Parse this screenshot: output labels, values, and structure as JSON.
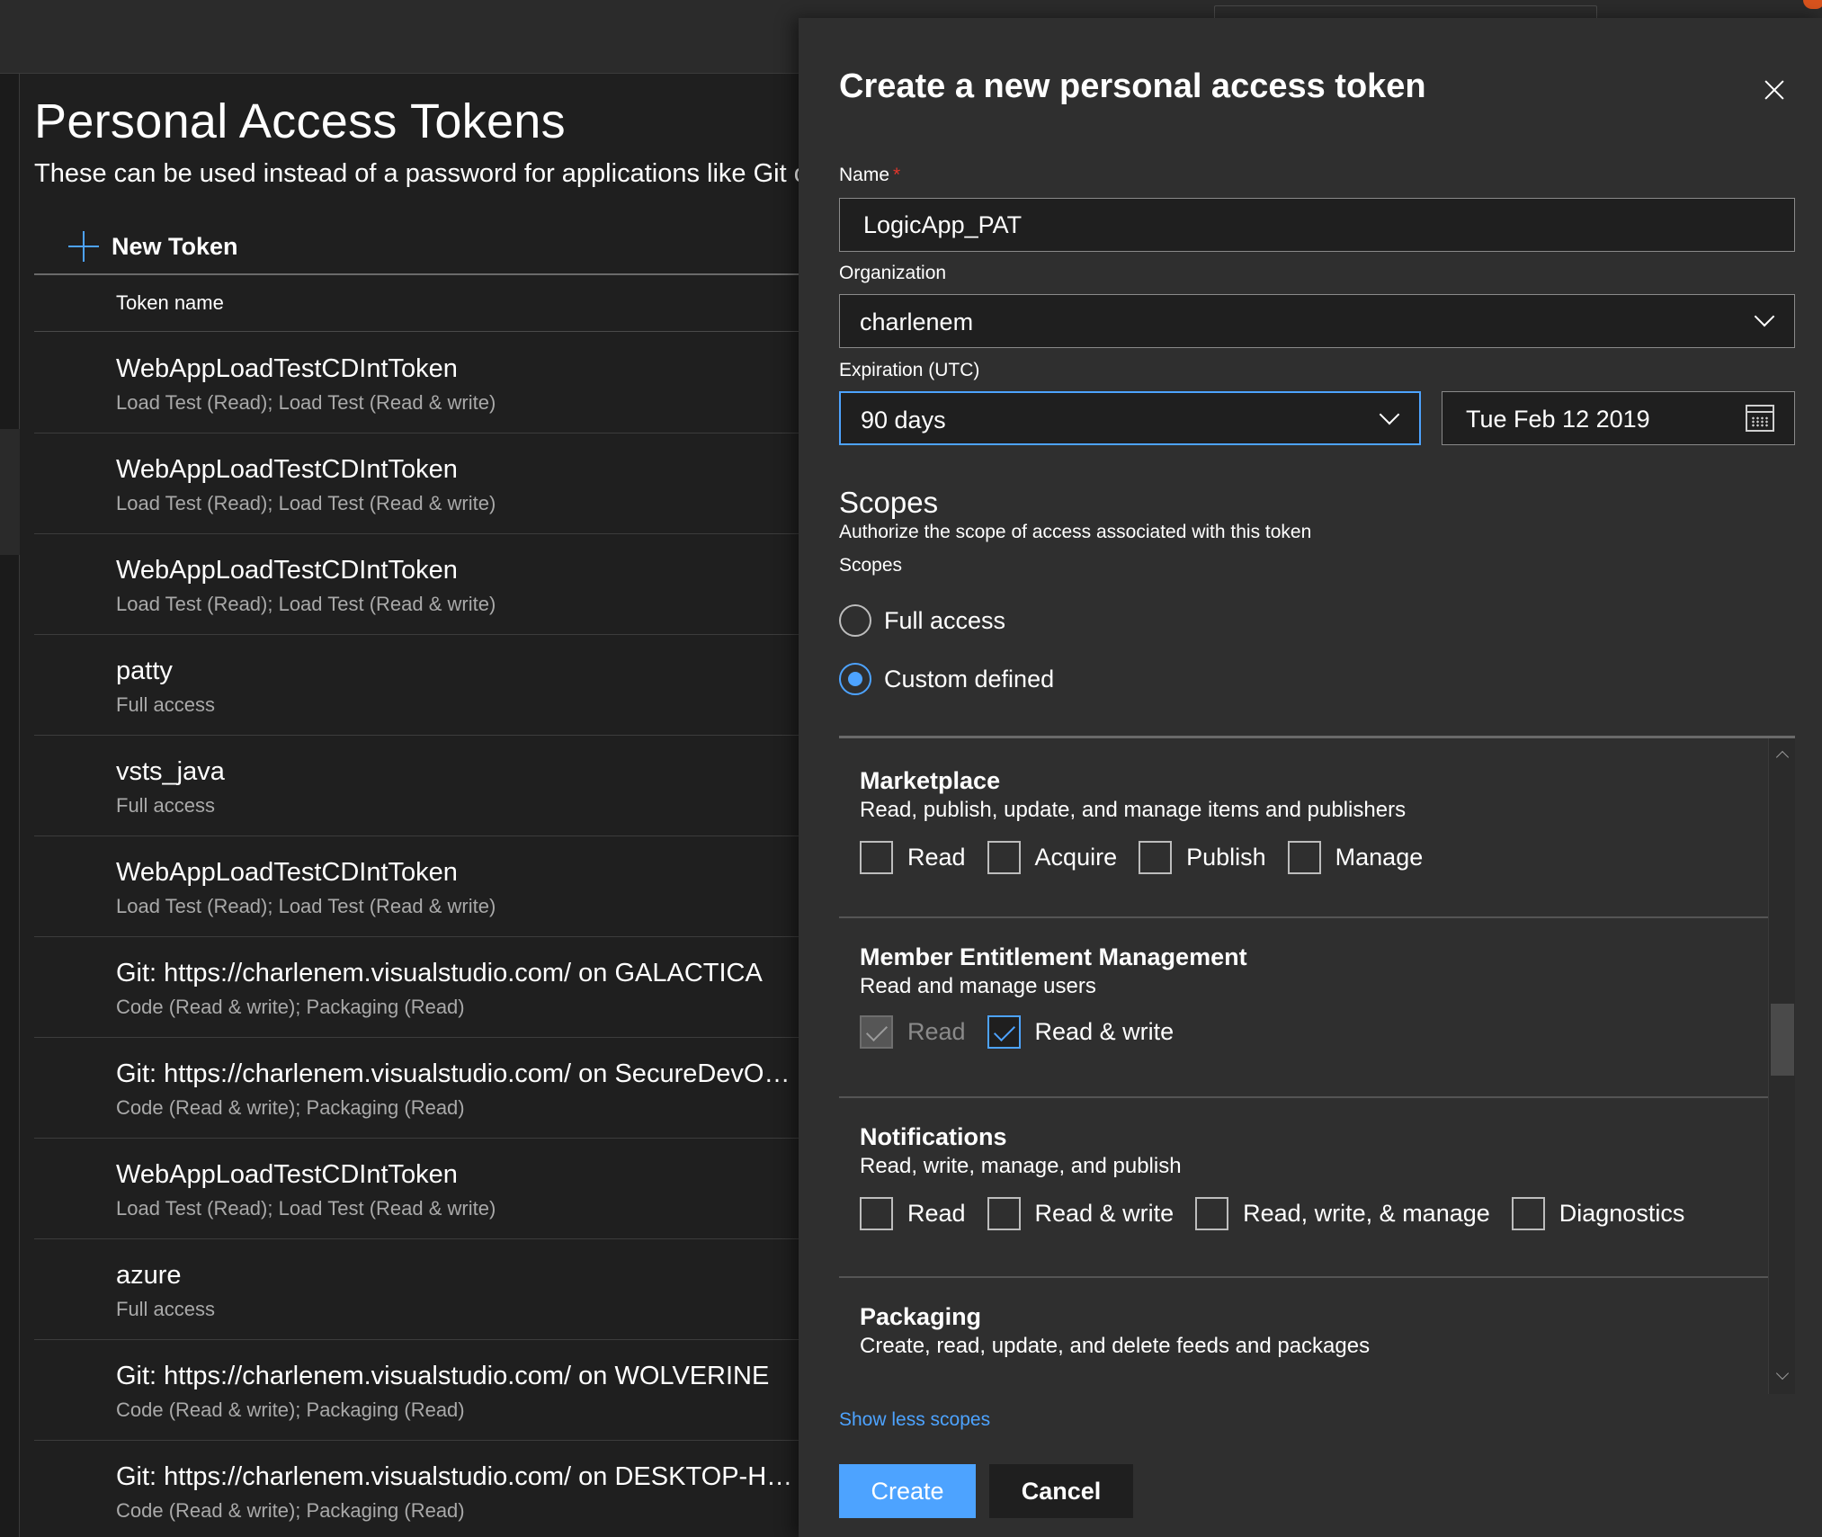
{
  "page": {
    "title": "Personal Access Tokens",
    "description": "These can be used instead of a password for applications like Git or",
    "new_token_label": "New Token",
    "column_header": "Token name",
    "tokens": [
      {
        "name": "WebAppLoadTestCDIntToken",
        "scope": "Load Test (Read); Load Test (Read & write)"
      },
      {
        "name": "WebAppLoadTestCDIntToken",
        "scope": "Load Test (Read); Load Test (Read & write)"
      },
      {
        "name": "WebAppLoadTestCDIntToken",
        "scope": "Load Test (Read); Load Test (Read & write)"
      },
      {
        "name": "patty",
        "scope": "Full access"
      },
      {
        "name": "vsts_java",
        "scope": "Full access"
      },
      {
        "name": "WebAppLoadTestCDIntToken",
        "scope": "Load Test (Read); Load Test (Read & write)"
      },
      {
        "name": "Git: https://charlenem.visualstudio.com/ on GALACTICA",
        "scope": "Code (Read & write); Packaging (Read)"
      },
      {
        "name": "Git: https://charlenem.visualstudio.com/ on SecureDevOps...",
        "scope": "Code (Read & write); Packaging (Read)"
      },
      {
        "name": "WebAppLoadTestCDIntToken",
        "scope": "Load Test (Read); Load Test (Read & write)"
      },
      {
        "name": "azure",
        "scope": "Full access"
      },
      {
        "name": "Git: https://charlenem.visualstudio.com/ on WOLVERINE",
        "scope": "Code (Read & write); Packaging (Read)"
      },
      {
        "name": "Git: https://charlenem.visualstudio.com/ on DESKTOP-HRU...",
        "scope": "Code (Read & write); Packaging (Read)"
      }
    ]
  },
  "panel": {
    "title": "Create a new personal access token",
    "name_label": "Name",
    "required_mark": "*",
    "name_value": "LogicApp_PAT",
    "organization_label": "Organization",
    "organization_value": "charlenem",
    "expiration_label": "Expiration (UTC)",
    "expiration_value": "90 days",
    "expiration_date": "Tue Feb 12 2019",
    "scopes_title": "Scopes",
    "scopes_desc": "Authorize the scope of access associated with this token",
    "scopes_label": "Scopes",
    "radio_full": "Full access",
    "radio_custom": "Custom defined",
    "selected_radio": "custom",
    "groups": {
      "marketplace": {
        "title": "Marketplace",
        "desc": "Read, publish, update, and manage items and publishers",
        "options": [
          "Read",
          "Acquire",
          "Publish",
          "Manage"
        ]
      },
      "member": {
        "title": "Member Entitlement Management",
        "desc": "Read and manage users",
        "options": [
          "Read",
          "Read & write"
        ]
      },
      "notifications": {
        "title": "Notifications",
        "desc": "Read, write, manage, and publish",
        "options": [
          "Read",
          "Read & write",
          "Read, write, & manage",
          "Diagnostics"
        ]
      },
      "packaging": {
        "title": "Packaging",
        "desc": "Create, read, update, and delete feeds and packages"
      }
    },
    "show_less": "Show less scopes",
    "create_label": "Create",
    "cancel_label": "Cancel"
  },
  "colors": {
    "accent": "#4da3ff",
    "background": "#1f1f1f",
    "panel": "#2f2f2f",
    "required": "#e0362c",
    "brand_dot": "#d8531d"
  }
}
